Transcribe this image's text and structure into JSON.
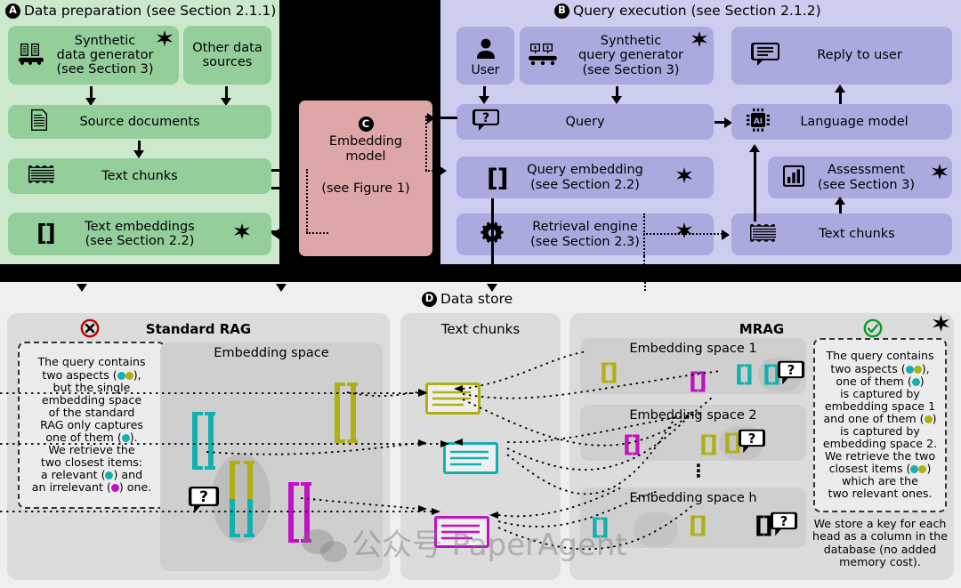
{
  "sections": {
    "a": {
      "badge": "A",
      "title": "Data preparation (see Section 2.1.1)"
    },
    "b": {
      "badge": "B",
      "title": "Query execution (see Section 2.1.2)"
    },
    "c": {
      "badge": "C",
      "title_line1": "Embedding",
      "title_line2": "model",
      "subtitle": "(see Figure 1)"
    },
    "d": {
      "badge": "D",
      "title": "Data store"
    }
  },
  "panel_a_boxes": [
    {
      "name": "synthetic-data-generator",
      "line1": "Synthetic",
      "line2": "data generator",
      "line3": "(see Section 3)",
      "icon": "factory-icon",
      "star": true
    },
    {
      "name": "other-data-sources",
      "line1": "Other data",
      "line2": "sources",
      "icon": "",
      "star": false
    },
    {
      "name": "source-documents",
      "line1": "Source documents",
      "icon": "document-icon",
      "star": false
    },
    {
      "name": "text-chunks",
      "line1": "Text chunks",
      "icon": "chunks-icon",
      "star": false
    },
    {
      "name": "text-embeddings",
      "line1": "Text embeddings",
      "line2": "(see Section 2.2)",
      "icon": "brackets-icon",
      "star": true
    }
  ],
  "panel_b_boxes": [
    {
      "name": "user",
      "line1": "User",
      "icon": "person-icon",
      "star": false
    },
    {
      "name": "synthetic-query-generator",
      "line1": "Synthetic",
      "line2": "query generator",
      "line3": "(see Section 3)",
      "icon": "factory-chat-icon",
      "star": true
    },
    {
      "name": "reply-to-user",
      "line1": "Reply to user",
      "icon": "speech-lines-icon",
      "star": false
    },
    {
      "name": "query",
      "line1": "Query",
      "icon": "question-bubble-icon",
      "star": false
    },
    {
      "name": "language-model",
      "line1": "Language model",
      "icon": "ai-chip-icon",
      "star": false
    },
    {
      "name": "query-embedding",
      "line1": "Query embedding",
      "line2": "(see Section 2.2)",
      "icon": "brackets-icon",
      "star": true
    },
    {
      "name": "assessment",
      "line1": "Assessment",
      "line2": "(see Section 3)",
      "icon": "bar-chart-icon",
      "star": true
    },
    {
      "name": "retrieval-engine",
      "line1": "Retrieval engine",
      "line2": "(see Section 2.3)",
      "icon": "gear-icon",
      "star": true
    },
    {
      "name": "text-chunks-b",
      "line1": "Text chunks",
      "icon": "chunks-icon",
      "star": false
    }
  ],
  "standard_rag": {
    "title": "Standard RAG",
    "status_icon": "cross-circle-icon",
    "embedding_space_title": "Embedding space",
    "callout": "The query contains two aspects (●●), but the single embedding space of the standard RAG only captures one of them (●). We retrieve the two closest items: a relevant (●) and an irrelevant (●) one.",
    "callout_parts": [
      "The query contains",
      "two aspects (",
      "),",
      "but the single",
      "embedding space",
      "of the standard",
      "RAG only captures",
      "one of them (",
      ").",
      "We retrieve the",
      "two closest items:",
      "a relevant (",
      ") and",
      "an irrelevant (",
      ") one."
    ]
  },
  "text_chunks_card": {
    "title": "Text chunks"
  },
  "mrag": {
    "title": "MRAG",
    "status_icon": "check-circle-icon",
    "star": true,
    "spaces": [
      {
        "name": "embedding-space-1",
        "title": "Embedding space 1"
      },
      {
        "name": "embedding-space-2",
        "title": "Embedding space 2"
      },
      {
        "name": "embedding-space-h",
        "title": "Embedding space h"
      }
    ],
    "callout_parts": [
      "The query contains",
      "two aspects (",
      "),",
      "one of them (",
      ")",
      "is captured by",
      "embedding space 1",
      "and one of them (",
      ")",
      "is captured by",
      "embedding space 2.",
      "We retrieve the two",
      "closest items (",
      ")",
      "which are the",
      "two relevant ones."
    ],
    "note_parts": [
      "We store a key for each",
      "head as a column in the",
      "database (no added",
      "memory cost)."
    ]
  },
  "watermark": {
    "text": "公众号 PaperAgent"
  },
  "colors": {
    "green_panel": "#cde9cd",
    "green_box": "#93ce9b",
    "purple_panel": "#cdcdef",
    "purple_box": "#aaaadf",
    "red_box": "#dda7a7",
    "teal": "#13b0b0",
    "olive": "#b0b013",
    "magenta": "#c410c4",
    "card": "#dcdcdc",
    "inner": "#cfcfcf"
  }
}
